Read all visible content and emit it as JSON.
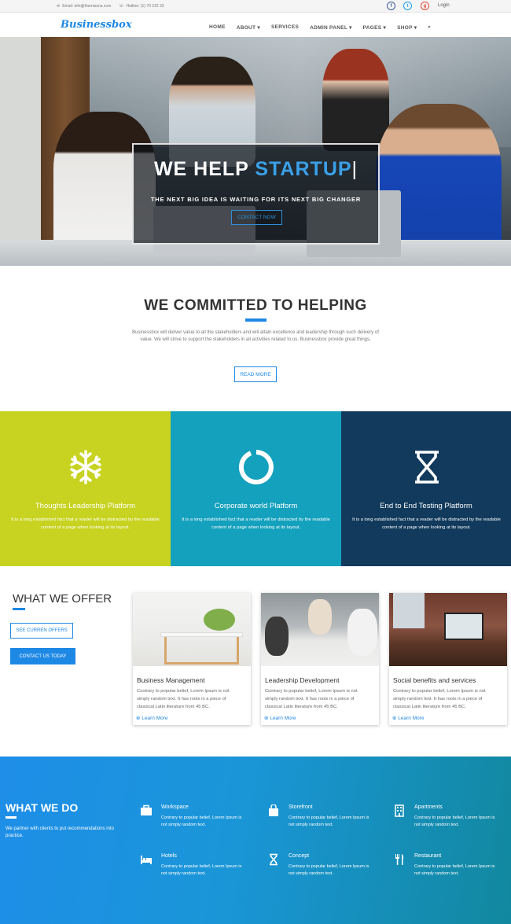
{
  "topbar": {
    "email": "Email: info@themisons.com",
    "phone": "Hotline: (1) 70 222 33",
    "login": "Login",
    "social": [
      "facebook-icon",
      "twitter-icon",
      "google-plus-icon"
    ]
  },
  "nav": {
    "logo": "Businessbox",
    "items": [
      "HOME",
      "ABOUT ▾",
      "SERVICES",
      "ADMIN PANEL ▾",
      "PAGES ▾",
      "SHOP ▾"
    ]
  },
  "hero": {
    "title_a": "WE HELP ",
    "title_b": "STARTUP",
    "subtitle": "THE NEXT BIG IDEA IS WAITING FOR ITS NEXT BIG CHANGER",
    "button": "CONTACT NOW"
  },
  "committed": {
    "title": "WE COMMITTED TO HELPING",
    "text": "Businessbox will deliver value to all the stakeholders and will attain excellence and leadership through such delivery of value. We will strive to support the stakeholders in all activities related to us. Businessbox provide great things.",
    "button": "READ MORE"
  },
  "features": [
    {
      "title": "Thoughts Leadership Platform",
      "text": "It is a long established fact that a reader will be distracted by the readable content of a page when looking at its layout.",
      "color": "#c7d320",
      "icon": "snowflake-icon"
    },
    {
      "title": "Corporate world Platform",
      "text": "It is a long established fact that a reader will be distracted by the readable content of a page when looking at its layout.",
      "color": "#14a1bd",
      "icon": "circle-icon"
    },
    {
      "title": "End to End Testing Platform",
      "text": "It is a long established fact that a reader will be distracted by the readable content of a page when looking at its layout.",
      "color": "#113a5c",
      "icon": "hourglass-icon"
    }
  ],
  "offer": {
    "title": "WHAT WE OFFER",
    "btn1": "SEE CURREN OFFERS",
    "btn2": "CONTACT US TODAY",
    "cards": [
      {
        "title": "Business Management",
        "text": "Contrary to popular belief, Lorem Ipsum is not simply random text. It has roots in a piece of classical Latin literature from 45 BC.",
        "link": "Learn More"
      },
      {
        "title": "Leadership Development",
        "text": "Contrary to popular belief, Lorem Ipsum is not simply random text. It has roots in a piece of classical Latin literature from 45 BC.",
        "link": "Learn More"
      },
      {
        "title": "Social benefits and services",
        "text": "Contrary to popular belief, Lorem Ipsum is not simply random text. It has roots in a piece of classical Latin literature from 45 BC.",
        "link": "Learn More"
      }
    ]
  },
  "whatwedo": {
    "title": "WHAT WE DO",
    "intro": "We partner with clients to put recommendations into practice.",
    "services": [
      {
        "title": "Workspace",
        "text": "Contrary to popular belief, Lorem Ipsum is not simply random text.",
        "icon": "briefcase-icon"
      },
      {
        "title": "Storefront",
        "text": "Contrary to popular belief, Lorem Ipsum is not simply random text.",
        "icon": "shopping-bag-icon"
      },
      {
        "title": "Apartments",
        "text": "Contrary to popular belief, Lorem Ipsum is not simply random text.",
        "icon": "building-icon"
      },
      {
        "title": "Hotels",
        "text": "Contrary to popular belief, Lorem Ipsum is not simply random text.",
        "icon": "bed-icon"
      },
      {
        "title": "Concept",
        "text": "Contrary to popular belief, Lorem Ipsum is not simply random text.",
        "icon": "hourglass-icon"
      },
      {
        "title": "Restaurant",
        "text": "Contrary to popular belief, Lorem Ipsum is not simply random text.",
        "icon": "cutlery-icon"
      }
    ]
  }
}
